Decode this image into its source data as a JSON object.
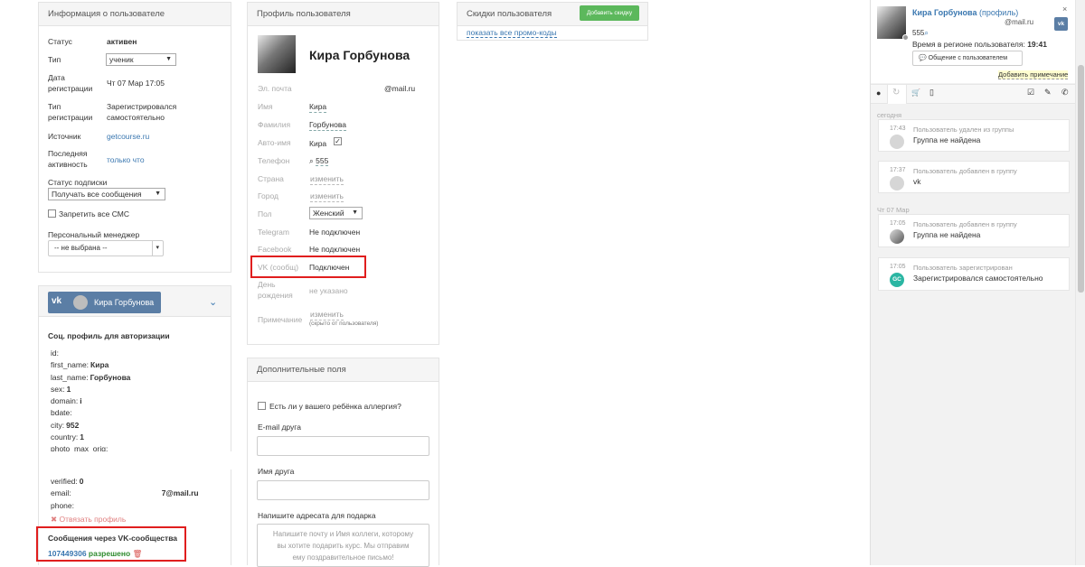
{
  "user_info": {
    "title": "Информация о пользователе",
    "status_label": "Статус",
    "status_value": "активен",
    "type_label": "Тип",
    "type_value": "ученик",
    "reg_date_label_1": "Дата",
    "reg_date_label_2": "регистрации",
    "reg_date_value": "Чт 07 Мар 17:05",
    "reg_type_label_1": "Тип",
    "reg_type_label_2": "регистрации",
    "reg_type_value_1": "Зарегистрировался",
    "reg_type_value_2": "самостоятельно",
    "source_label": "Источник",
    "source_value": "getcourse.ru",
    "last_active_label_1": "Последняя",
    "last_active_label_2": "активность",
    "last_active_value": "только что",
    "sub_status_label": "Статус подписки",
    "sub_status_value": "Получать все сообщения",
    "ban_sms_label": "Запретить все СМС",
    "manager_label": "Персональный менеджер",
    "manager_value": "-- не выбрана --"
  },
  "vk": {
    "name": "Кира Горбунова",
    "social_title": "Соц. профиль для авторизации",
    "fields": [
      {
        "k": "id:",
        "v": ""
      },
      {
        "k": "first_name:",
        "v": "Кира"
      },
      {
        "k": "last_name:",
        "v": "Горбунова"
      },
      {
        "k": "sex:",
        "v": "1"
      },
      {
        "k": "domain:",
        "v": "i"
      },
      {
        "k": "bdate:",
        "v": ""
      },
      {
        "k": "city:",
        "v": "952"
      },
      {
        "k": "country:",
        "v": "1"
      },
      {
        "k": "photo_max_orig:",
        "v": ""
      }
    ],
    "fields2": [
      {
        "k": "verified:",
        "v": "0"
      },
      {
        "k": "email:",
        "v": "7@mail.ru"
      },
      {
        "k": "phone:",
        "v": ""
      }
    ],
    "unlink_label": "Отвязать профиль",
    "messages_title": "Сообщения через VK-сообщества",
    "group_id": "107449306",
    "allowed": "разрешено"
  },
  "profile": {
    "title": "Профиль пользователя",
    "name": "Кира Горбунова",
    "email_label": "Эл. почта",
    "email_value": "@mail.ru",
    "first_label": "Имя",
    "first_value": "Кира",
    "last_label": "Фамилия",
    "last_value": "Горбунова",
    "autoname_label": "Авто-имя",
    "autoname_value": "Кира",
    "phone_label": "Телефон",
    "phone_value": "555",
    "country_label": "Страна",
    "country_value": "изменить",
    "city_label": "Город",
    "city_value": "изменить",
    "sex_label": "Пол",
    "sex_value": "Женский",
    "telegram_label": "Telegram",
    "telegram_value": "Не подключен",
    "facebook_label": "Facebook",
    "facebook_value": "Не подключен",
    "vk_label": "VK (сообщ)",
    "vk_value": "Подключен",
    "bday_label_1": "День",
    "bday_label_2": "рождения",
    "bday_value": "не указано",
    "note_label": "Примечание",
    "note_value": "изменить",
    "note_hint": "(скрыто от пользователя)"
  },
  "extra": {
    "title": "Дополнительные поля",
    "allergy_label": "Есть ли у вашего ребёнка аллергия?",
    "friend_email_label": "E-mail друга",
    "friend_name_label": "Имя друга",
    "gift_label": "Напишите адресата для подарка",
    "gift_placeholder_1": "Напишите почту и Имя коллеги, которому",
    "gift_placeholder_2": "вы хотите подарить курс. Мы отправим",
    "gift_placeholder_3": "ему поздравительное письмо!"
  },
  "discounts": {
    "title": "Скидки пользователя",
    "add_button": "Добавить скидку",
    "show_promo": "показать все промо-коды"
  },
  "right": {
    "name": "Кира Горбунова",
    "profile_link": "(профиль)",
    "email": "@mail.ru",
    "phone": "555",
    "time_label": "Время в регионе пользователя:",
    "time_value": "19:41",
    "chat_button": "Общение с пользователем",
    "add_note": "Добавить примечание",
    "day_today": "сегодня",
    "day_thu": "Чт 07 Мар",
    "events": [
      {
        "time": "17:43",
        "head": "Пользователь удален из группы",
        "body": "Группа не найдена"
      },
      {
        "time": "17:37",
        "head": "Пользователь добавлен в группу",
        "body": "vk"
      },
      {
        "time": "17:05",
        "head": "Пользователь добавлен в группу",
        "body": "Группа не найдена"
      },
      {
        "time": "17:05",
        "head": "Пользователь зарегистрирован",
        "body": "Зарегистрировался самостоятельно"
      }
    ],
    "gc_badge": "GC"
  },
  "colors": {
    "accent": "#3a77b0",
    "green": "#5cb85c",
    "red": "#e01e1e",
    "vk": "#5b7ea5"
  }
}
